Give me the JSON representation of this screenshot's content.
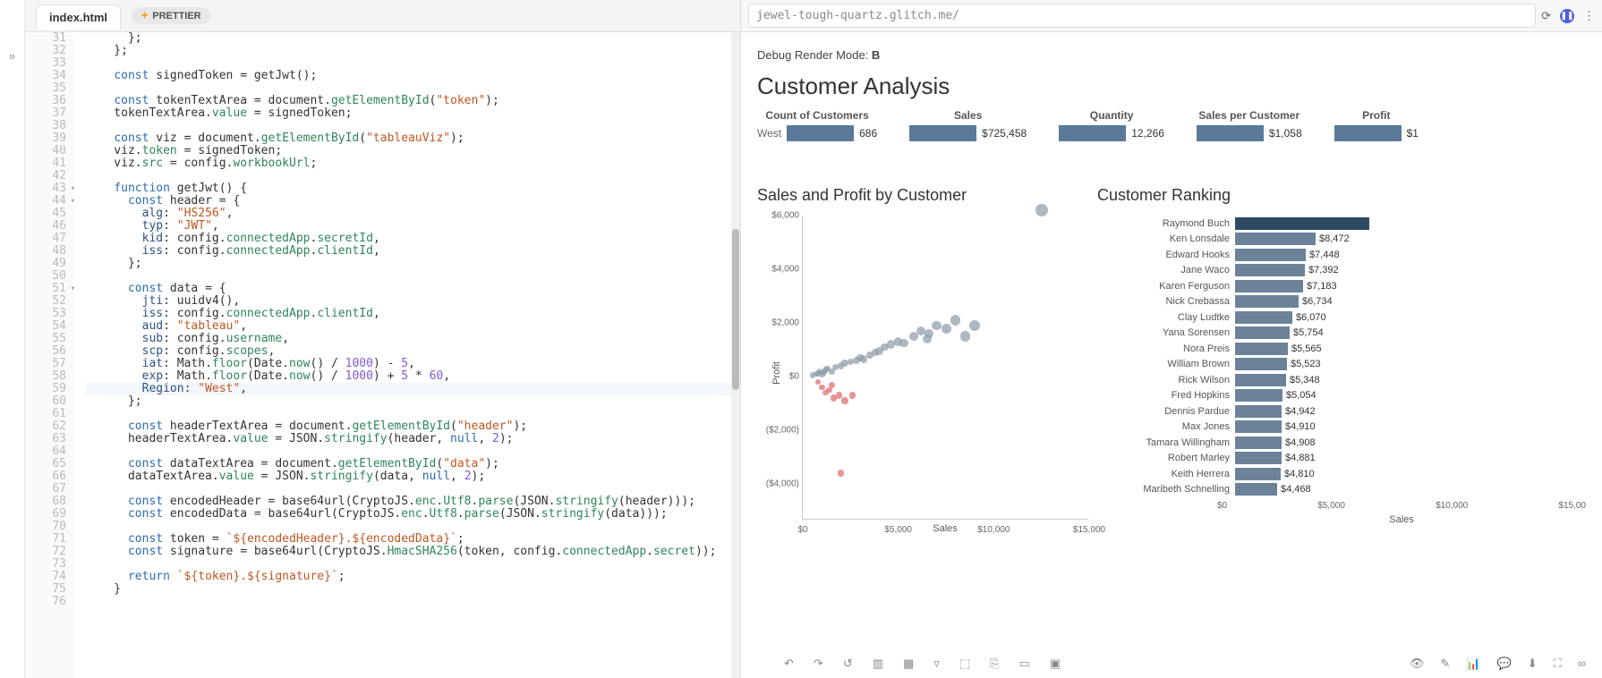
{
  "tabs": {
    "file": "index.html",
    "prettier": "PRETTIER"
  },
  "url_bar": {
    "url": "jewel-tough-quartz.glitch.me/"
  },
  "debug": {
    "prefix": "Debug Render Mode: ",
    "mode": "B"
  },
  "dash": {
    "title": "Customer Analysis"
  },
  "kpi": {
    "region": "West",
    "items": [
      {
        "label": "Count of Customers",
        "value": "686",
        "w": 75
      },
      {
        "label": "Sales",
        "value": "$725,458",
        "w": 75
      },
      {
        "label": "Quantity",
        "value": "12,266",
        "w": 75
      },
      {
        "label": "Sales per Customer",
        "value": "$1,058",
        "w": 75
      },
      {
        "label": "Profit",
        "value": "$1",
        "w": 75
      }
    ]
  },
  "scatter": {
    "title": "Sales and Profit by Customer",
    "xlabel": "Sales",
    "ylabel": "Profit"
  },
  "ranking": {
    "title": "Customer Ranking",
    "xlabel": "Sales",
    "rows": [
      {
        "name": "Raymond Buch",
        "value": "",
        "w": 150,
        "top": true
      },
      {
        "name": "Ken Lonsdale",
        "value": "$8,472",
        "w": 90
      },
      {
        "name": "Edward Hooks",
        "value": "$7,448",
        "w": 79
      },
      {
        "name": "Jane Waco",
        "value": "$7,392",
        "w": 78
      },
      {
        "name": "Karen Ferguson",
        "value": "$7,183",
        "w": 76
      },
      {
        "name": "Nick Crebassa",
        "value": "$6,734",
        "w": 71
      },
      {
        "name": "Clay Ludtke",
        "value": "$6,070",
        "w": 64
      },
      {
        "name": "Yana Sorensen",
        "value": "$5,754",
        "w": 61
      },
      {
        "name": "Nora Preis",
        "value": "$5,565",
        "w": 59
      },
      {
        "name": "William Brown",
        "value": "$5,523",
        "w": 58
      },
      {
        "name": "Rick Wilson",
        "value": "$5,348",
        "w": 57
      },
      {
        "name": "Fred Hopkins",
        "value": "$5,054",
        "w": 53
      },
      {
        "name": "Dennis Pardue",
        "value": "$4,942",
        "w": 52
      },
      {
        "name": "Max Jones",
        "value": "$4,910",
        "w": 52
      },
      {
        "name": "Tamara Willingham",
        "value": "$4,908",
        "w": 52
      },
      {
        "name": "Robert Marley",
        "value": "$4,881",
        "w": 52
      },
      {
        "name": "Keith Herrera",
        "value": "$4,810",
        "w": 51
      },
      {
        "name": "Maribeth Schnelling",
        "value": "$4,468",
        "w": 47
      }
    ],
    "xticks": [
      "$0",
      "$5,000",
      "$10,000",
      "$15,00"
    ]
  },
  "chart_data": {
    "type": "scatter",
    "title": "Sales and Profit by Customer",
    "xlabel": "Sales",
    "ylabel": "Profit",
    "xlim": [
      0,
      15000
    ],
    "ylim": [
      -4000,
      6000
    ],
    "xticks": [
      0,
      5000,
      10000,
      15000
    ],
    "yticks": [
      -4000,
      -2000,
      0,
      2000,
      4000,
      6000
    ],
    "ytick_labels": [
      "($4,000)",
      "($2,000)",
      "$0",
      "$2,000",
      "$4,000",
      "$6,000"
    ],
    "xtick_labels": [
      "$0",
      "$5,000",
      "$10,000",
      "$15,000"
    ],
    "series": [
      {
        "name": "positive",
        "color": "#8a9aa8",
        "points": [
          [
            500,
            50
          ],
          [
            700,
            100
          ],
          [
            800,
            120
          ],
          [
            900,
            200
          ],
          [
            1000,
            80
          ],
          [
            1100,
            150
          ],
          [
            1200,
            250
          ],
          [
            1300,
            300
          ],
          [
            1500,
            180
          ],
          [
            1700,
            350
          ],
          [
            2000,
            400
          ],
          [
            2200,
            500
          ],
          [
            2500,
            550
          ],
          [
            2800,
            600
          ],
          [
            3000,
            700
          ],
          [
            3200,
            650
          ],
          [
            3500,
            800
          ],
          [
            3800,
            900
          ],
          [
            4000,
            950
          ],
          [
            4300,
            1100
          ],
          [
            4600,
            1200
          ],
          [
            5000,
            1300
          ],
          [
            5300,
            1250
          ],
          [
            5800,
            1500
          ],
          [
            6200,
            1700
          ],
          [
            6600,
            1600
          ],
          [
            7000,
            1900
          ],
          [
            7500,
            1800
          ],
          [
            8000,
            2100
          ],
          [
            8500,
            1500
          ],
          [
            9000,
            1900
          ],
          [
            6500,
            1400
          ],
          [
            12500,
            6200
          ]
        ]
      },
      {
        "name": "negative",
        "color": "#d66",
        "points": [
          [
            800,
            -200
          ],
          [
            1000,
            -400
          ],
          [
            1200,
            -600
          ],
          [
            1400,
            -500
          ],
          [
            1600,
            -800
          ],
          [
            1900,
            -700
          ],
          [
            2200,
            -900
          ],
          [
            1500,
            -300
          ],
          [
            2600,
            -700
          ],
          [
            2000,
            -3600
          ]
        ]
      }
    ]
  },
  "code": {
    "start_line": 31,
    "fold_lines": [
      43,
      44,
      51
    ],
    "highlight_line": 59,
    "lines": [
      "      };",
      "    };",
      "",
      "    const signedToken = getJwt();",
      "",
      "    const tokenTextArea = document.getElementById(\"token\");",
      "    tokenTextArea.value = signedToken;",
      "",
      "    const viz = document.getElementById(\"tableauViz\");",
      "    viz.token = signedToken;",
      "    viz.src = config.workbookUrl;",
      "",
      "    function getJwt() {",
      "      const header = {",
      "        alg: \"HS256\",",
      "        typ: \"JWT\",",
      "        kid: config.connectedApp.secretId,",
      "        iss: config.connectedApp.clientId,",
      "      };",
      "",
      "      const data = {",
      "        jti: uuidv4(),",
      "        iss: config.connectedApp.clientId,",
      "        aud: \"tableau\",",
      "        sub: config.username,",
      "        scp: config.scopes,",
      "        iat: Math.floor(Date.now() / 1000) - 5,",
      "        exp: Math.floor(Date.now() / 1000) + 5 * 60,",
      "        Region: \"West\",",
      "      };",
      "",
      "      const headerTextArea = document.getElementById(\"header\");",
      "      headerTextArea.value = JSON.stringify(header, null, 2);",
      "",
      "      const dataTextArea = document.getElementById(\"data\");",
      "      dataTextArea.value = JSON.stringify(data, null, 2);",
      "",
      "      const encodedHeader = base64url(CryptoJS.enc.Utf8.parse(JSON.stringify(header)));",
      "      const encodedData = base64url(CryptoJS.enc.Utf8.parse(JSON.stringify(data)));",
      "",
      "      const token = `${encodedHeader}.${encodedData}`;",
      "      const signature = base64url(CryptoJS.HmacSHA256(token, config.connectedApp.secret));",
      "",
      "      return `${token}.${signature}`;",
      "    }",
      ""
    ]
  }
}
